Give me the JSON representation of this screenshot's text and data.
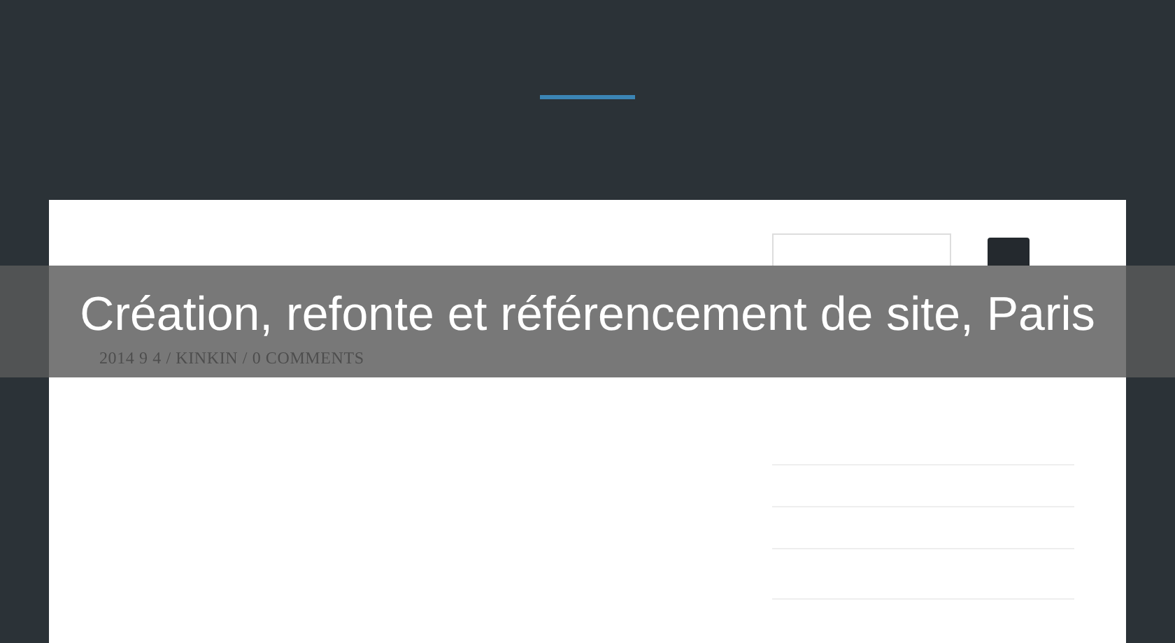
{
  "post": {
    "meta": "2014 9 4 / KINKIN / 0 COMMENTS"
  },
  "banner": {
    "title": "Création, refonte et référencement de site, Paris"
  }
}
